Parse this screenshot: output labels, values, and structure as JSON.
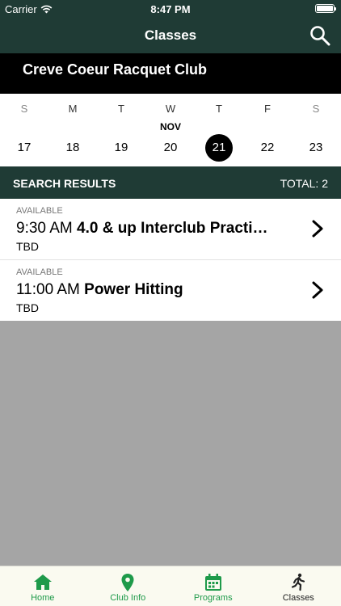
{
  "status_bar": {
    "carrier": "Carrier",
    "time": "8:47 PM"
  },
  "nav": {
    "title": "Classes",
    "search_icon": "search-icon"
  },
  "club": {
    "name": "Creve Coeur Racquet Club"
  },
  "calendar": {
    "month": "NOV",
    "days": [
      {
        "dow": "S",
        "date": "17"
      },
      {
        "dow": "M",
        "date": "18"
      },
      {
        "dow": "T",
        "date": "19"
      },
      {
        "dow": "W",
        "date": "20"
      },
      {
        "dow": "T",
        "date": "21"
      },
      {
        "dow": "F",
        "date": "22"
      },
      {
        "dow": "S",
        "date": "23"
      }
    ],
    "selected": "21"
  },
  "results": {
    "label": "SEARCH RESULTS",
    "total": "TOTAL: 2",
    "items": [
      {
        "status": "AVAILABLE",
        "time": "9:30 AM",
        "name": "4.0 & up Interclub Practi…",
        "location": "TBD"
      },
      {
        "status": "AVAILABLE",
        "time": "11:00 AM",
        "name": "Power Hitting",
        "location": "TBD"
      }
    ]
  },
  "tabs": [
    {
      "label": "Home",
      "icon": "home-icon"
    },
    {
      "label": "Club Info",
      "icon": "map-pin-icon"
    },
    {
      "label": "Programs",
      "icon": "calendar-icon"
    },
    {
      "label": "Classes",
      "icon": "runner-icon"
    }
  ],
  "colors": {
    "header": "#1f3b35",
    "accent": "#1e9a4a",
    "tab_bg": "#fafaf0",
    "empty_area": "#a5a5a5"
  }
}
